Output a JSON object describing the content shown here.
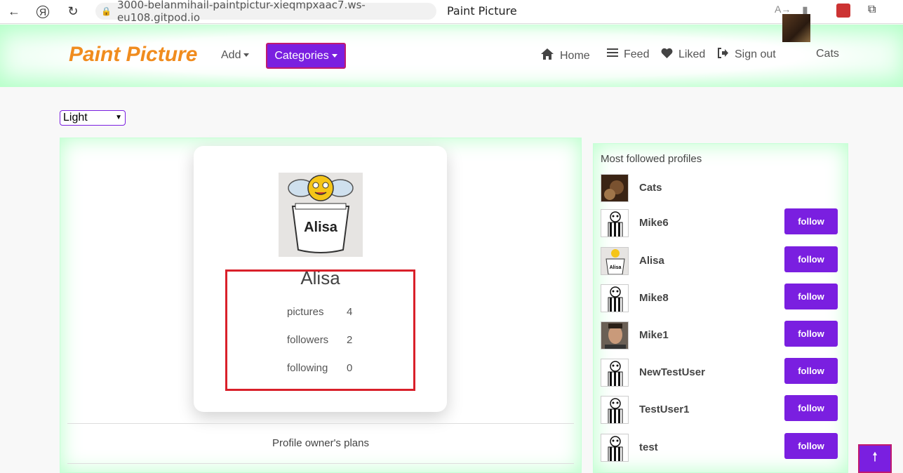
{
  "browser": {
    "url": "3000-belanmihail-paintpictur-xieqmpxaac7.ws-eu108.gitpod.io",
    "tab_title": "Paint Picture"
  },
  "nav": {
    "brand": "Paint Picture",
    "add_label": "Add",
    "categories_label": "Categories",
    "home": "Home",
    "feed": "Feed",
    "liked": "Liked",
    "sign_out": "Sign out",
    "user": "Cats"
  },
  "theme": {
    "selected": "Light"
  },
  "profile": {
    "name": "Alisa",
    "stats": [
      {
        "label": "pictures",
        "value": "4"
      },
      {
        "label": "followers",
        "value": "2"
      },
      {
        "label": "following",
        "value": "0"
      }
    ],
    "plans_label": "Profile owner's plans"
  },
  "side": {
    "title": "Most followed profiles",
    "follow_label": "follow",
    "profiles": [
      {
        "name": "Cats",
        "avatar": "cat-photo",
        "follow": false
      },
      {
        "name": "Mike6",
        "avatar": "default-avatar",
        "follow": true
      },
      {
        "name": "Alisa",
        "avatar": "alisa-photo",
        "follow": true
      },
      {
        "name": "Mike8",
        "avatar": "default-avatar",
        "follow": true
      },
      {
        "name": "Mike1",
        "avatar": "man-photo",
        "follow": true
      },
      {
        "name": "NewTestUser",
        "avatar": "default-avatar",
        "follow": true
      },
      {
        "name": "TestUser1",
        "avatar": "default-avatar",
        "follow": true
      },
      {
        "name": "test",
        "avatar": "default-avatar",
        "follow": true
      }
    ]
  },
  "colors": {
    "brand": "#f08c1e",
    "accent": "#7a1fe0",
    "highlight": "#d9202a"
  }
}
